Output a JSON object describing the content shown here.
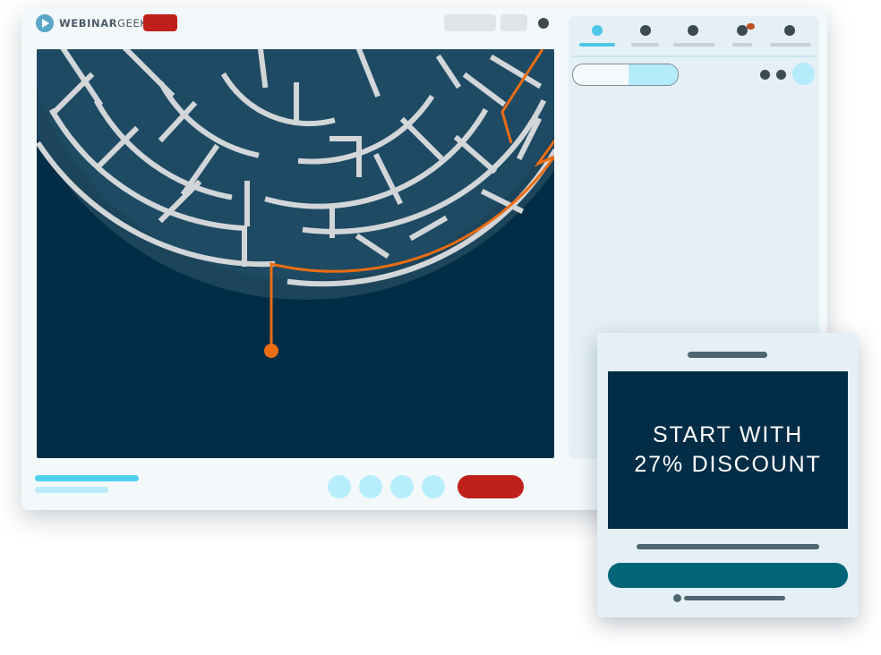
{
  "app": {
    "brand_bold": "WEBINAR",
    "brand_light": "GEEK"
  },
  "colors": {
    "accent_cyan": "#4fd1ee",
    "live_red": "#c0201b",
    "video_navy": "#032d46",
    "maze_path_orange": "#ec6d12",
    "panel_bg": "#e4f0f5",
    "offer_button_teal": "#016477"
  },
  "icons": {
    "logo": "play-icon"
  },
  "sidebar": {
    "tabs_count": 5,
    "active_tab": 0
  },
  "offer": {
    "headline_line1": "START WITH",
    "headline_line2": "27% DISCOUNT"
  }
}
